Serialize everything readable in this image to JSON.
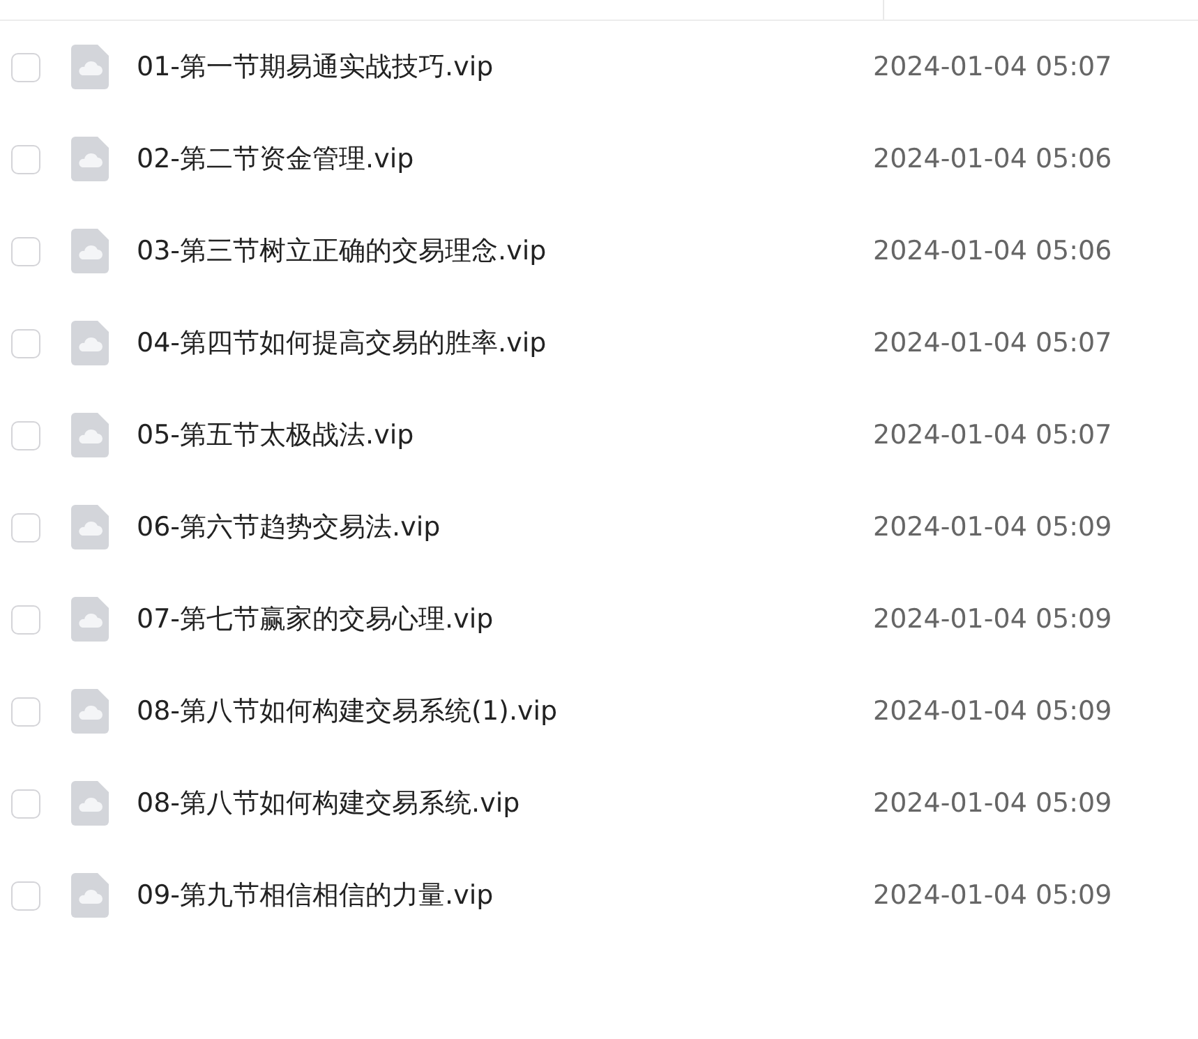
{
  "files": [
    {
      "name": "01-第一节期易通实战技巧.vip",
      "modified": "2024-01-04 05:07",
      "checked": false
    },
    {
      "name": "02-第二节资金管理.vip",
      "modified": "2024-01-04 05:06",
      "checked": false
    },
    {
      "name": "03-第三节树立正确的交易理念.vip",
      "modified": "2024-01-04 05:06",
      "checked": false
    },
    {
      "name": "04-第四节如何提高交易的胜率.vip",
      "modified": "2024-01-04 05:07",
      "checked": false
    },
    {
      "name": "05-第五节太极战法.vip",
      "modified": "2024-01-04 05:07",
      "checked": false
    },
    {
      "name": "06-第六节趋势交易法.vip",
      "modified": "2024-01-04 05:09",
      "checked": false
    },
    {
      "name": "07-第七节赢家的交易心理.vip",
      "modified": "2024-01-04 05:09",
      "checked": false
    },
    {
      "name": "08-第八节如何构建交易系统(1).vip",
      "modified": "2024-01-04 05:09",
      "checked": false
    },
    {
      "name": "08-第八节如何构建交易系统.vip",
      "modified": "2024-01-04 05:09",
      "checked": false
    },
    {
      "name": "09-第九节相信相信的力量.vip",
      "modified": "2024-01-04 05:09",
      "checked": false
    }
  ]
}
